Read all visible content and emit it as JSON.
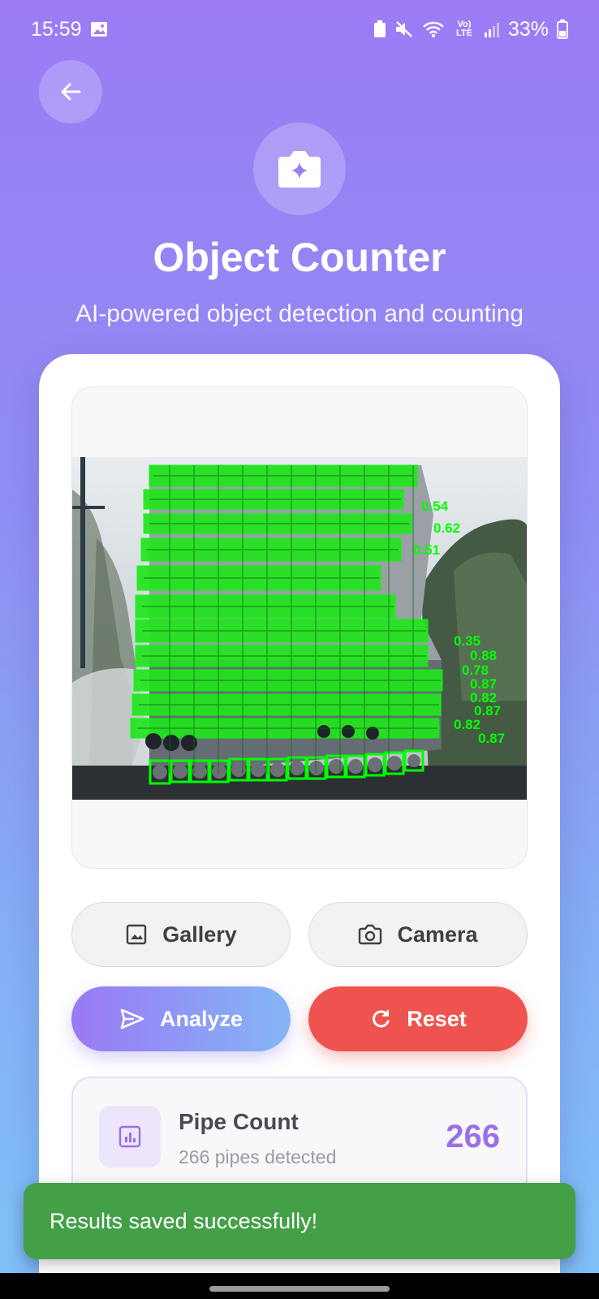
{
  "status_bar": {
    "time": "15:59",
    "battery": "33%",
    "network": "Vo) LTE"
  },
  "header": {
    "back_icon": "arrow-left-icon",
    "hero_icon": "camera-sparkle-icon",
    "title": "Object Counter",
    "subtitle": "AI-powered object detection and counting"
  },
  "image_preview": {
    "detection_labels": [
      "0.54",
      "0.62",
      "0.51",
      "0.35",
      "0.88",
      "0.78",
      "0.87",
      "0.82",
      "0.87",
      "0.82",
      "0.87"
    ]
  },
  "actions": {
    "gallery_label": "Gallery",
    "camera_label": "Camera",
    "analyze_label": "Analyze",
    "reset_label": "Reset"
  },
  "result": {
    "title": "Pipe Count",
    "subtitle": "266 pipes detected",
    "count": "266"
  },
  "snackbar": {
    "message": "Results saved successfully!"
  },
  "colors": {
    "accent": "#9b6fe8",
    "reset": "#ef5350",
    "snackbar": "#43a047",
    "detection_box": "#00ff00"
  }
}
